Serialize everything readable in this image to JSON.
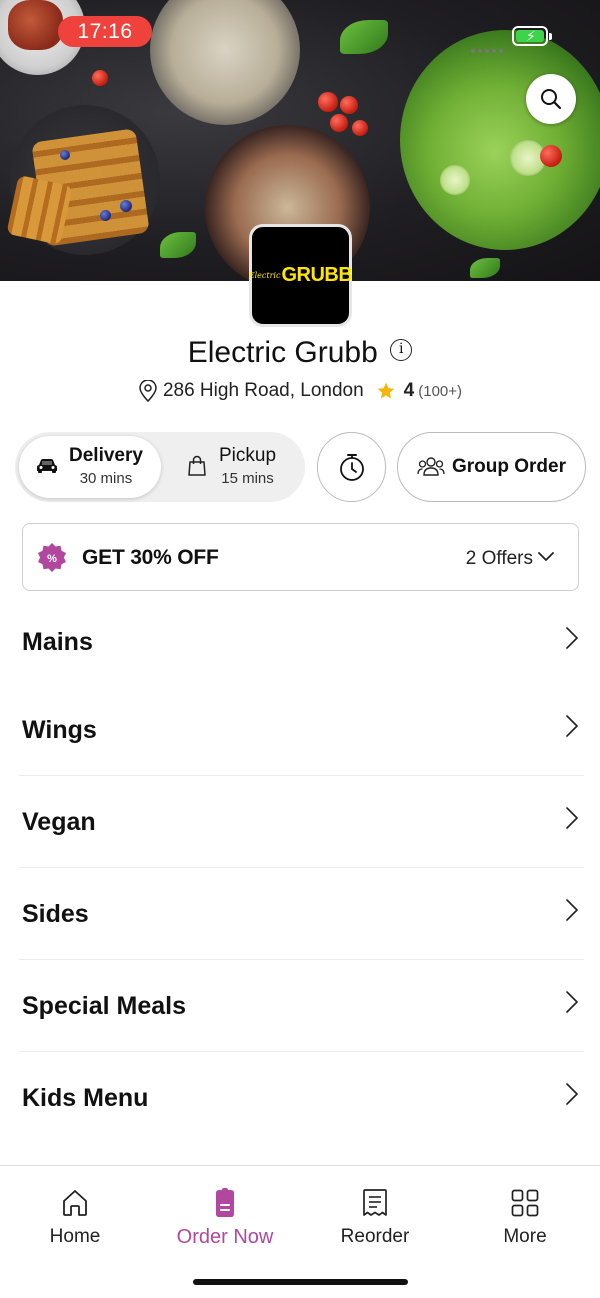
{
  "status_bar": {
    "time": "17:16"
  },
  "restaurant": {
    "logo_text_small": "Electric",
    "logo_text_big": "GRUBB",
    "name": "Electric Grubb",
    "address": "286 High Road, London",
    "rating": "4",
    "rating_count": "(100+)"
  },
  "order_modes": {
    "delivery": {
      "label": "Delivery",
      "time": "30 mins",
      "selected": true
    },
    "pickup": {
      "label": "Pickup",
      "time": "15 mins",
      "selected": false
    }
  },
  "group_order_label": "Group Order",
  "offer": {
    "title": "GET 30% OFF",
    "count_label": "2 Offers"
  },
  "menu_categories": [
    {
      "label": "Mains"
    },
    {
      "label": "Wings"
    },
    {
      "label": "Vegan"
    },
    {
      "label": "Sides"
    },
    {
      "label": "Special Meals"
    },
    {
      "label": "Kids Menu"
    }
  ],
  "bottom_nav": [
    {
      "label": "Home",
      "icon": "home-icon",
      "active": false
    },
    {
      "label": "Order Now",
      "icon": "order-icon",
      "active": true
    },
    {
      "label": "Reorder",
      "icon": "receipt-icon",
      "active": false
    },
    {
      "label": "More",
      "icon": "grid-icon",
      "active": false
    }
  ],
  "colors": {
    "accent": "#b2479f",
    "time_pill": "#f0423c",
    "battery": "#3dd34a",
    "star": "#f5b50a",
    "offer_badge": "#b2479f"
  }
}
